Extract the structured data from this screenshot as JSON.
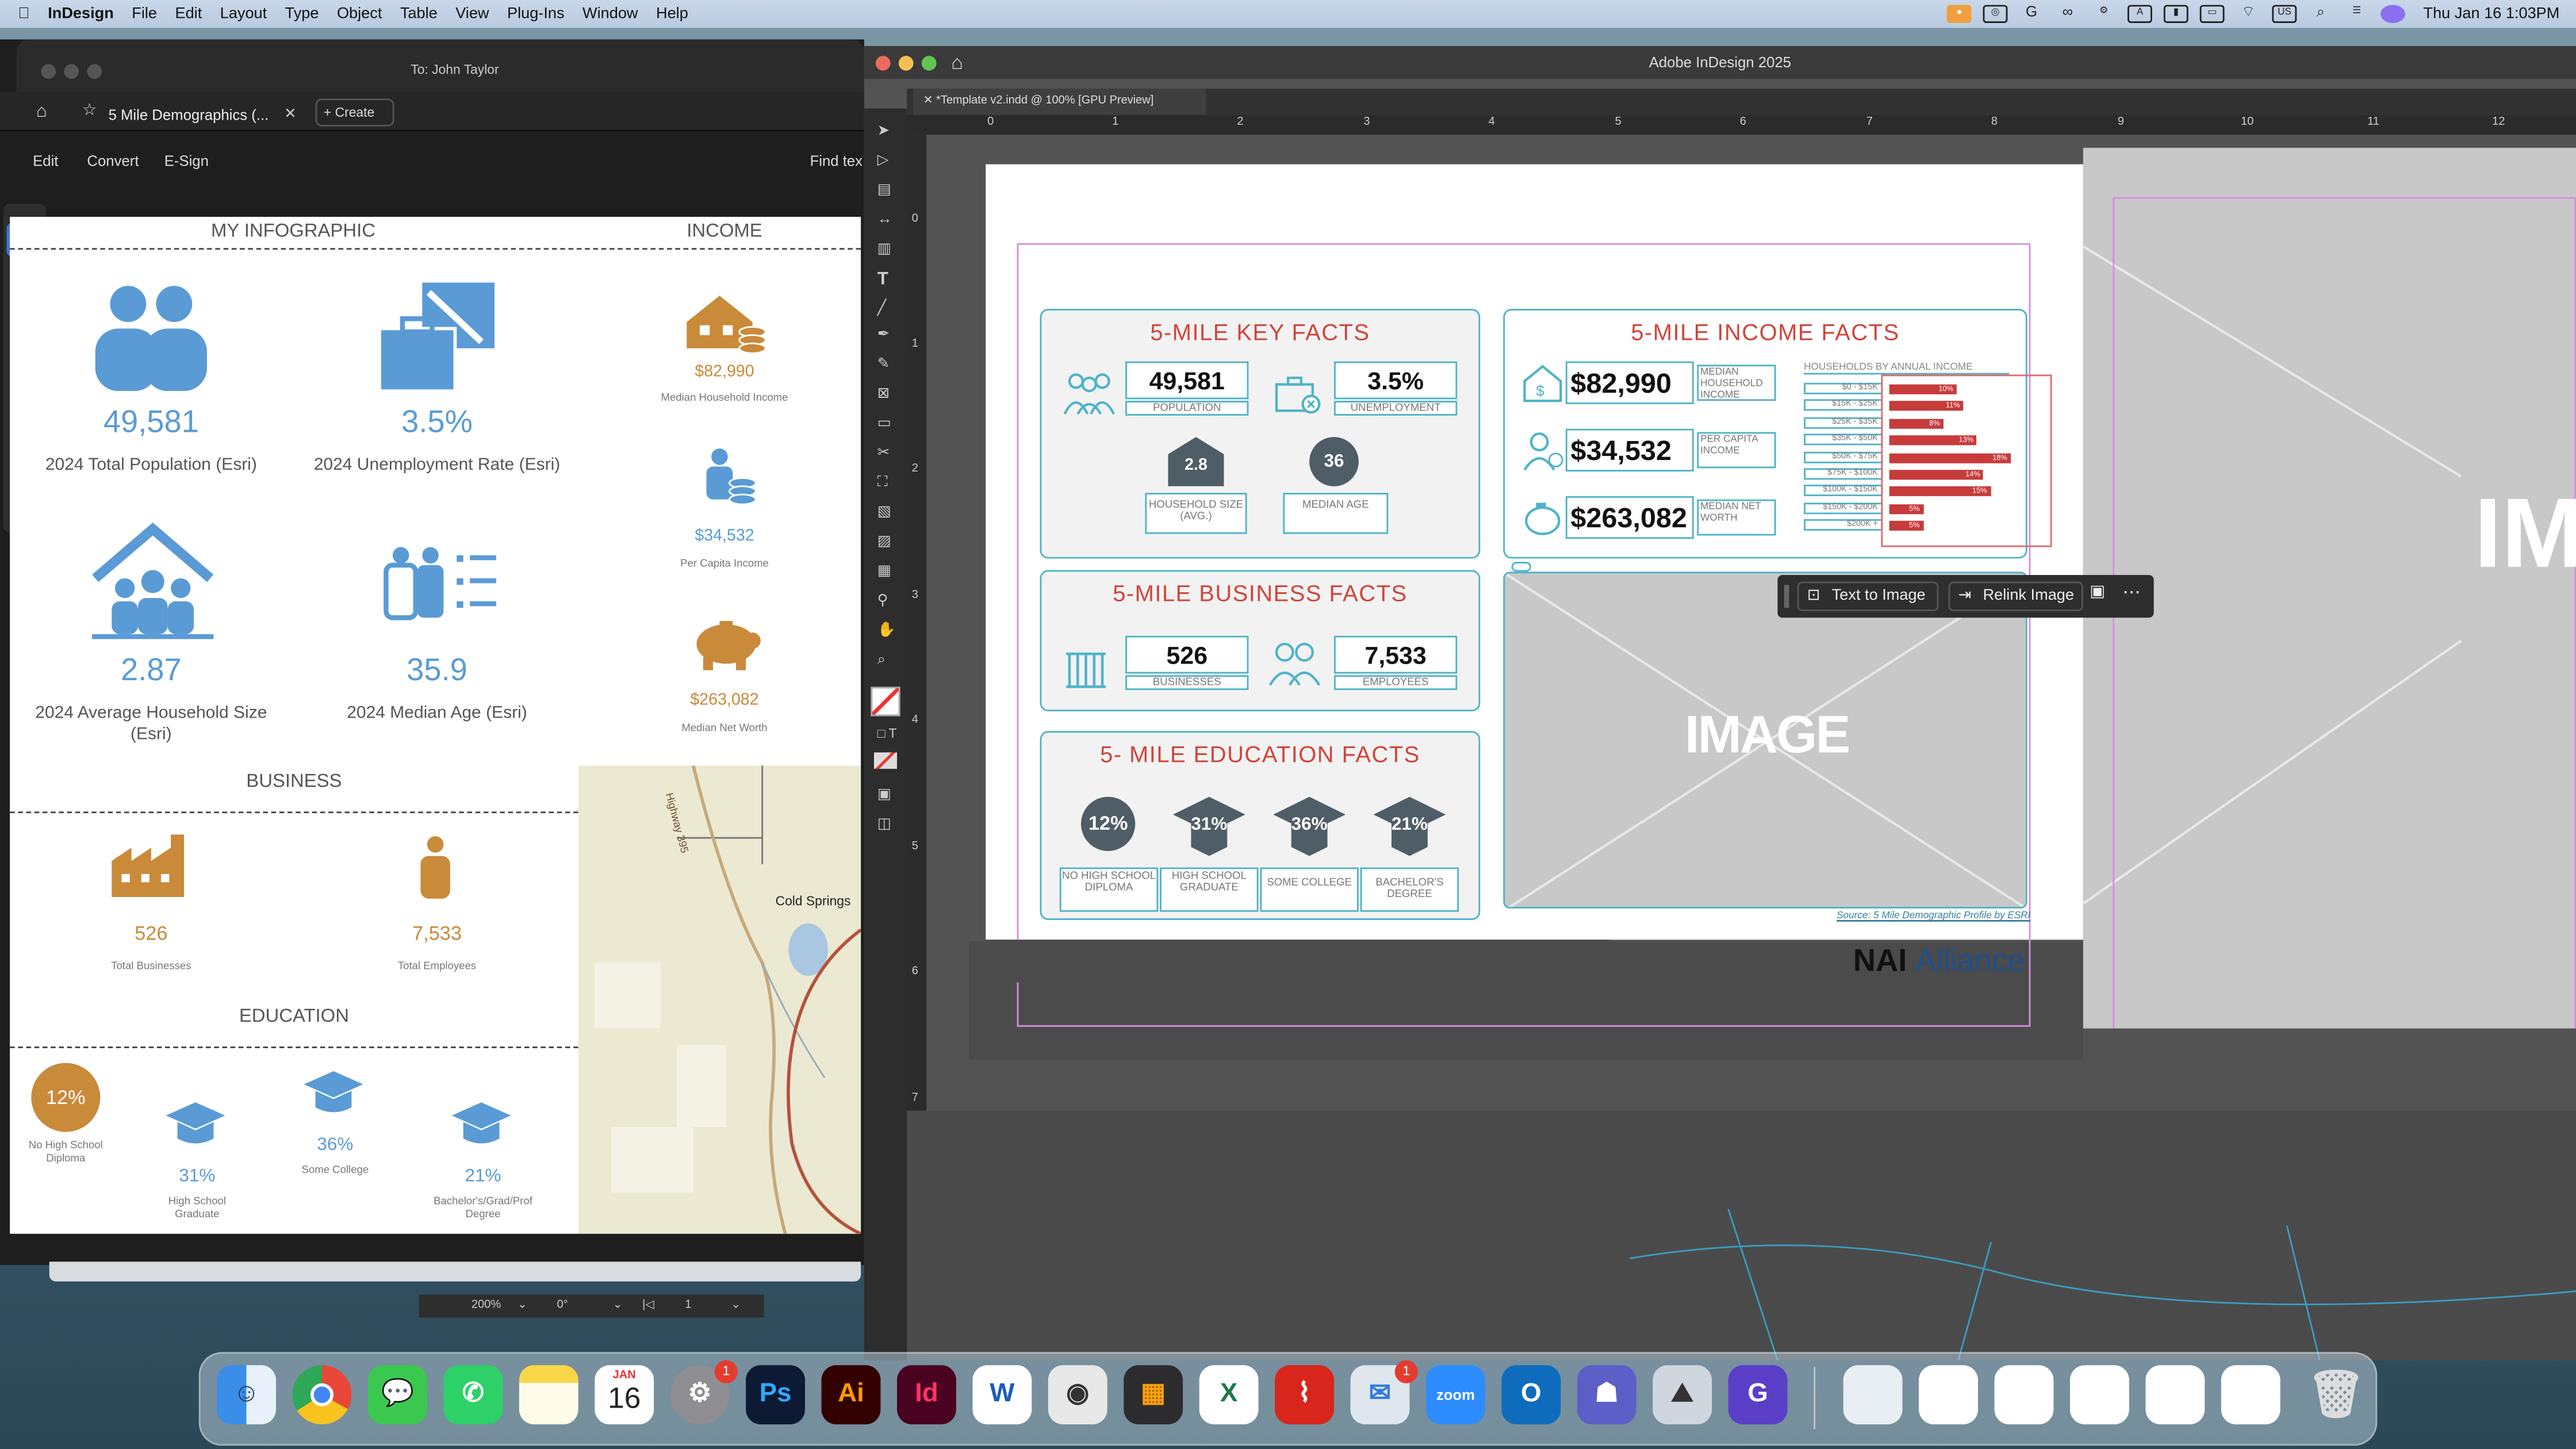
{
  "menubar": {
    "app": "InDesign",
    "items": [
      "File",
      "Edit",
      "Layout",
      "Type",
      "Object",
      "Table",
      "View",
      "Plug-Ins",
      "Window",
      "Help"
    ],
    "clock": "Thu Jan 16  1:03PM",
    "lang": "US"
  },
  "acrobat": {
    "to": "To: John Taylor",
    "tab_title": "5 Mile Demographics (...",
    "create": "Create",
    "menu": [
      "Edit",
      "Convert",
      "E-Sign"
    ],
    "find": "Find tex",
    "zoom": "200%",
    "rotate": "0°",
    "page": "1"
  },
  "infographic": {
    "my_title": "MY INFOGRAPHIC",
    "income_title": "INCOME",
    "business_title": "BUSINESS",
    "education_title": "EDUCATION",
    "population": {
      "value": "49,581",
      "label": "2024 Total Population (Esri)"
    },
    "unemployment": {
      "value": "3.5%",
      "label": "2024 Unemployment Rate (Esri)"
    },
    "household": {
      "value": "2.87",
      "label": "2024 Average Household Size (Esri)"
    },
    "median_age": {
      "value": "35.9",
      "label": "2024 Median Age (Esri)"
    },
    "median_hh_income": {
      "value": "$82,990",
      "label": "Median Household Income"
    },
    "per_capita": {
      "value": "$34,532",
      "label": "Per Capita Income"
    },
    "net_worth": {
      "value": "$263,082",
      "label": "Median Net Worth"
    },
    "businesses": {
      "value": "526",
      "label": "Total Businesses"
    },
    "employees": {
      "value": "7,533",
      "label": "Total Employees"
    },
    "edu": [
      {
        "value": "12%",
        "label": "No High School Diploma"
      },
      {
        "value": "31%",
        "label": "High School Graduate"
      },
      {
        "value": "36%",
        "label": "Some College"
      },
      {
        "value": "21%",
        "label": "Bachelor's/Grad/Prof Degree"
      }
    ],
    "map": {
      "road": "Highway 395",
      "town": "Cold Springs"
    }
  },
  "indesign": {
    "window_title": "Adobe InDesign 2025",
    "doc_tab": "*Template v2.indd @ 100% [GPU Preview]",
    "ruler_h": [
      "0",
      "1",
      "2",
      "3",
      "4",
      "5",
      "6",
      "7",
      "8",
      "9",
      "10",
      "11",
      "12"
    ],
    "ruler_v": [
      "0",
      "1",
      "2",
      "3",
      "4",
      "5",
      "6",
      "7",
      "1"
    ],
    "key_facts": {
      "title": "5-MILE KEY FACTS",
      "population": "49,581",
      "population_cap": "POPULATION",
      "unemployment": "3.5%",
      "unemployment_cap": "UNEMPLOYMENT",
      "household": "2.8",
      "household_cap": "HOUSEHOLD SIZE (AVG.)",
      "age": "36",
      "age_cap": "MEDIAN AGE"
    },
    "business_facts": {
      "title": "5-MILE BUSINESS FACTS",
      "businesses": "526",
      "businesses_cap": "BUSINESSES",
      "employees": "7,533",
      "employees_cap": "EMPLOYEES"
    },
    "education_facts": {
      "title": "5- MILE EDUCATION FACTS",
      "items": [
        {
          "value": "12%",
          "cap": "NO HIGH SCHOOL DIPLOMA"
        },
        {
          "value": "31%",
          "cap": "HIGH SCHOOL GRADUATE"
        },
        {
          "value": "36%",
          "cap": "SOME COLLEGE"
        },
        {
          "value": "21%",
          "cap": "BACHELOR'S DEGREE"
        }
      ]
    },
    "income_facts": {
      "title": "5-MILE INCOME FACTS",
      "median": "$82,990",
      "median_cap": "MEDIAN HOUSEHOLD INCOME",
      "per_capita": "$34,532",
      "per_capita_cap": "PER CAPITA INCOME",
      "net_worth": "$263,082",
      "net_worth_cap": "MEDIAN NET WORTH",
      "chart_title": "HOUSEHOLDS BY ANNUAL INCOME"
    },
    "image_placeholder": "IMAGE",
    "source": "Source: 5 Mile Demographic Profile by ESRI",
    "logo": {
      "nai": "NAI",
      "alliance": "Alliance"
    },
    "context_bar": {
      "text_to_image": "Text to Image",
      "relink": "Relink Image"
    },
    "right_image": "IM"
  },
  "chart_data": {
    "type": "bar",
    "title": "HOUSEHOLDS BY ANNUAL INCOME",
    "categories": [
      "$0 - $15K",
      "$15K - $25K",
      "$25K - $35K",
      "$35K - $50K",
      "$50K - $75K",
      "$75K - $100K",
      "$100K - $150K",
      "$150K - $200K",
      "$200K +"
    ],
    "values": [
      10,
      11,
      8,
      13,
      18,
      14,
      15,
      5,
      5
    ],
    "value_labels": [
      "10%",
      "11%",
      "8%",
      "13%",
      "18%",
      "14%",
      "15%",
      "5%",
      "5%"
    ],
    "xlim": [
      0,
      20
    ],
    "orientation": "horizontal",
    "color": "#c73b3b"
  },
  "dock": {
    "calendar_month": "JAN",
    "calendar_day": "16",
    "settings_badge": "1",
    "mail_badge": "1",
    "apps": [
      "Ps",
      "Ai",
      "Id",
      "W",
      "X",
      "zoom",
      "O",
      "G"
    ]
  },
  "colors": {
    "accent_blue": "#5a9bd5",
    "gold": "#c98a3a",
    "red": "#d0453a",
    "teal": "#4fb3c8",
    "bar": "#c73b3b"
  }
}
